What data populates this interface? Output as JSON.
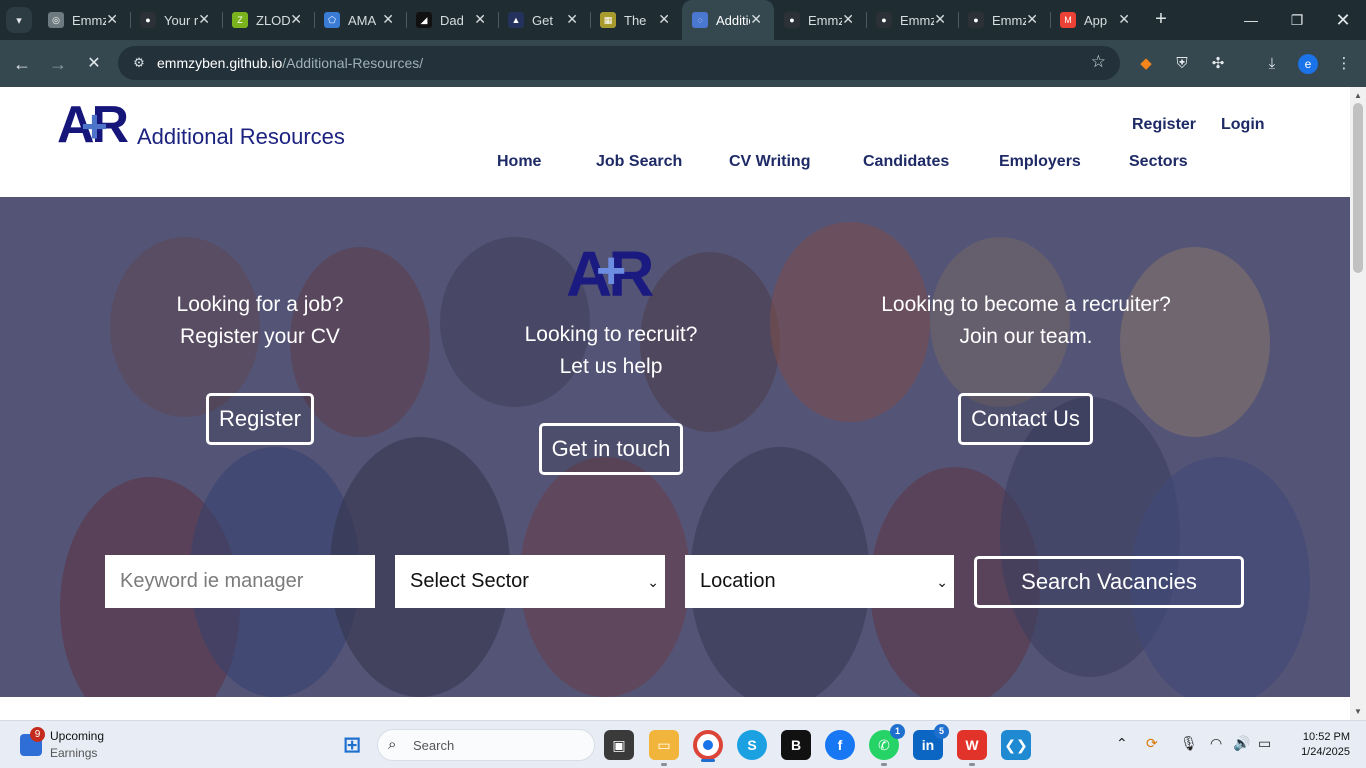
{
  "browser": {
    "tabs": [
      {
        "title": "Emmzyben",
        "color": "#6d7a80",
        "glyph": "◎"
      },
      {
        "title": "Your repositories",
        "color": "#2b3137",
        "glyph": "●"
      },
      {
        "title": "ZLOD",
        "color": "#7bb31e",
        "glyph": "Z"
      },
      {
        "title": "AMA",
        "color": "#3a7bd5",
        "glyph": "⬠"
      },
      {
        "title": "Dad",
        "color": "#111111",
        "glyph": "◢"
      },
      {
        "title": "Get",
        "color": "#23315c",
        "glyph": "▲"
      },
      {
        "title": "The",
        "color": "#a99a2e",
        "glyph": "▦"
      },
      {
        "title": "Additional Resources",
        "color": "#4a78d0",
        "glyph": "◌"
      },
      {
        "title": "Emmzyben",
        "color": "#2b3137",
        "glyph": "●"
      },
      {
        "title": "Emmzyben",
        "color": "#2b3137",
        "glyph": "●"
      },
      {
        "title": "Emmzyben",
        "color": "#2b3137",
        "glyph": "●"
      },
      {
        "title": "App",
        "color": "#ea4335",
        "glyph": "M"
      }
    ],
    "active_tab_index": 7,
    "url_host": "emmzyben.github.io",
    "url_path": "/Additional-Resources/"
  },
  "site": {
    "logo_letters": "AR",
    "logo_plus": "+",
    "logo_name": "Additional Resources",
    "auth": {
      "register": "Register",
      "login": "Login"
    },
    "menu": {
      "home": "Home",
      "job_search": "Job Search",
      "cv_writing": "CV Writing",
      "candidates": "Candidates",
      "employers": "Employers",
      "sectors": "Sectors"
    },
    "hero": {
      "left_line1": "Looking for a job?",
      "left_line2": "Register your CV",
      "left_button": "Register",
      "center_line1": "Looking to recruit?",
      "center_line2": "Let us help",
      "center_button": "Get in touch",
      "right_line1": "Looking to become a recruiter?",
      "right_line2": "Join our team.",
      "right_button": "Contact Us"
    },
    "search": {
      "keyword_placeholder": "Keyword ie manager",
      "sector_selected": "Select Sector",
      "location_selected": "Location",
      "button": "Search Vacancies"
    }
  },
  "taskbar": {
    "widget_badge": "9",
    "widget_line1": "Upcoming",
    "widget_line2": "Earnings",
    "search_label": "Search",
    "whatsapp_badge": "1",
    "linkedin_badge": "5",
    "time": "10:52 PM",
    "date": "1/24/2025"
  }
}
